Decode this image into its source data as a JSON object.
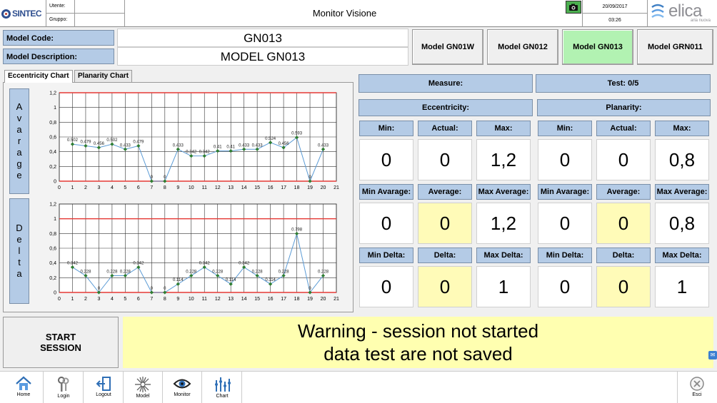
{
  "header": {
    "brand_left": "SINTEC",
    "user_label": "Utente:",
    "user_value": "",
    "group_label": "Gruppo:",
    "group_value": "",
    "title": "Monitor Visione",
    "date": "20/09/2017",
    "time": "03:26",
    "brand_right": "elica",
    "brand_right_tagline": "aria nuova"
  },
  "model": {
    "code_label": "Model Code:",
    "code_value": "GN013",
    "desc_label": "Model Description:",
    "desc_value": "MODEL GN013",
    "buttons": [
      {
        "label": "Model GN01W",
        "active": false
      },
      {
        "label": "Model GN012",
        "active": false
      },
      {
        "label": "Model GN013",
        "active": true
      },
      {
        "label": "Model GRN011",
        "active": false
      }
    ],
    "active_color": "#b2f2b2"
  },
  "tabs": [
    {
      "label": "Eccentricity Chart",
      "active": true
    },
    {
      "label": "Planarity Chart",
      "active": false
    }
  ],
  "side_labels": {
    "average": [
      "A",
      "v",
      "a",
      "r",
      "a",
      "g",
      "e"
    ],
    "delta": [
      "D",
      "e",
      "l",
      "t",
      "a"
    ]
  },
  "chart_data": [
    {
      "type": "line",
      "x": [
        1,
        2,
        3,
        4,
        5,
        6,
        7,
        8,
        9,
        10,
        11,
        12,
        13,
        14,
        15,
        16,
        17,
        18,
        19,
        20
      ],
      "values": [
        0.502,
        0.479,
        0.456,
        0.502,
        0.433,
        0.479,
        0,
        0,
        0.433,
        0.342,
        0.342,
        0.41,
        0.41,
        0.433,
        0.433,
        0.524,
        0.456,
        0.593,
        0,
        0.433
      ],
      "point_labels": [
        "0.502",
        "0.479",
        "0.456",
        "0.502",
        "0.433",
        "0.479",
        "0",
        "0",
        "0.433",
        "0.342",
        "0.342",
        "0.41",
        "0.41",
        "0.433",
        "0.433",
        "0.524",
        "0.456",
        "0.593",
        "0",
        "0.433"
      ],
      "xticks": [
        "0",
        "1",
        "2",
        "3",
        "4",
        "5",
        "6",
        "7",
        "8",
        "9",
        "10",
        "11",
        "12",
        "13",
        "14",
        "15",
        "16",
        "17",
        "18",
        "19",
        "20",
        "21"
      ],
      "yticks": [
        "0",
        "0,2",
        "0,4",
        "0,6",
        "0,8",
        "1",
        "1,2"
      ],
      "xlim": [
        0,
        21
      ],
      "ylim": [
        0,
        1.2
      ],
      "limit_lines": [
        0,
        1.2
      ],
      "grid": true,
      "colors": {
        "line": "#5b9bd5",
        "marker": "#2e7d32",
        "limit": "#e53935"
      }
    },
    {
      "type": "line",
      "x": [
        1,
        2,
        3,
        4,
        5,
        6,
        7,
        8,
        9,
        10,
        11,
        12,
        13,
        14,
        15,
        16,
        17,
        18,
        19,
        20
      ],
      "values": [
        0.342,
        0.228,
        0,
        0.228,
        0.228,
        0.342,
        0,
        0,
        0.114,
        0.228,
        0.342,
        0.228,
        0.114,
        0.342,
        0.228,
        0.114,
        0.228,
        0.798,
        0,
        0.228
      ],
      "point_labels": [
        "0.342",
        "0.228",
        "0",
        "0.228",
        "0.228",
        "0.342",
        "0",
        "0",
        "0.114",
        "0.228",
        "0.342",
        "0.228",
        "0.114",
        "0.342",
        "0.228",
        "0.114",
        "0.228",
        "0.798",
        "0",
        "0.228"
      ],
      "xticks": [
        "0",
        "1",
        "2",
        "3",
        "4",
        "5",
        "6",
        "7",
        "8",
        "9",
        "10",
        "11",
        "12",
        "13",
        "14",
        "15",
        "16",
        "17",
        "18",
        "19",
        "20",
        "21"
      ],
      "yticks": [
        "0",
        "0,2",
        "0,4",
        "0,6",
        "0,8",
        "1",
        "1,2"
      ],
      "xlim": [
        0,
        21
      ],
      "ylim": [
        0,
        1.2
      ],
      "limit_lines": [
        0,
        1
      ],
      "grid": true,
      "colors": {
        "line": "#5b9bd5",
        "marker": "#2e7d32",
        "limit": "#e53935"
      }
    }
  ],
  "measure": {
    "measure_label": "Measure:",
    "test_label": "Test: 0/5",
    "eccentricity_label": "Eccentricity:",
    "planarity_label": "Planarity:",
    "ecc": {
      "min_label": "Min:",
      "actual_label": "Actual:",
      "max_label": "Max:",
      "min": "0",
      "actual": "0",
      "max": "1,2",
      "min_avg_label": "Min Avarage:",
      "avg_label": "Average:",
      "max_avg_label": "Max Average:",
      "min_avg": "0",
      "avg": "0",
      "max_avg": "1,2",
      "min_delta_label": "Min Delta:",
      "delta_label": "Delta:",
      "max_delta_label": "Max Delta:",
      "min_delta": "0",
      "delta": "0",
      "max_delta": "1"
    },
    "plan": {
      "min_label": "Min:",
      "actual_label": "Actual:",
      "max_label": "Max:",
      "min": "0",
      "actual": "0",
      "max": "0,8",
      "min_avg_label": "Min Avarage:",
      "avg_label": "Average:",
      "max_avg_label": "Max Average:",
      "min_avg": "0",
      "avg": "0",
      "max_avg": "0,8",
      "min_delta_label": "Min Delta:",
      "delta_label": "Delta:",
      "max_delta_label": "Max Delta:",
      "min_delta": "0",
      "delta": "0",
      "max_delta": "1"
    }
  },
  "session": {
    "start_line1": "START",
    "start_line2": "SESSION",
    "warning_line1": "Warning - session not started",
    "warning_line2": "data test are not saved"
  },
  "toolbar": {
    "home": "Home",
    "login": "Login",
    "logout": "Logout",
    "model": "Model",
    "monitor": "Monitor",
    "chart": "Chart",
    "exit": "Esci"
  },
  "icons": {
    "camera": "camera-icon",
    "home": "home-icon",
    "login": "keys-icon",
    "logout": "logout-icon",
    "model": "model-icon",
    "monitor": "eye-icon",
    "chart": "chart-icon",
    "exit": "exit-icon"
  }
}
